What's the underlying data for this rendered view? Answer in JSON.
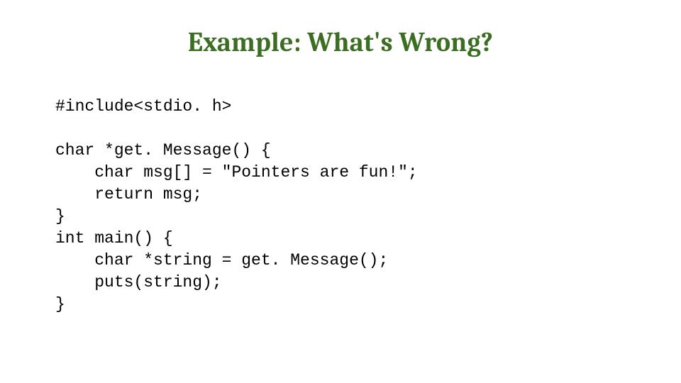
{
  "slide": {
    "title": "Example: What's Wrong?",
    "code": "#include<stdio. h>\n\nchar *get. Message() {\n    char msg[] = \"Pointers are fun!\";\n    return msg;\n}\nint main() {\n    char *string = get. Message();\n    puts(string);\n}"
  }
}
